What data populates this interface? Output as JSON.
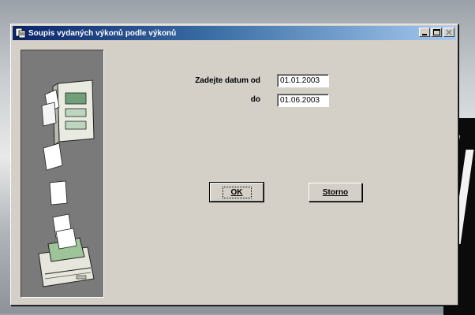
{
  "window": {
    "title": "Soupis vydaných výkonů podle výkonů"
  },
  "form": {
    "label_from": "Zadejte datum od",
    "label_to": "do",
    "date_from": "01.01.2003",
    "date_to": "01.06.2003"
  },
  "buttons": {
    "ok_label": "OK",
    "cancel_label": "Storno"
  },
  "icons": {
    "app": "app-icon",
    "minimize": "minimize-icon",
    "maximize": "maximize-icon",
    "close": "close-icon",
    "illustration": "printer-illustration"
  },
  "colors": {
    "title_start": "#0a246a",
    "title_end": "#a6caf0",
    "face": "#d4d0c8",
    "side_panel": "#7a7a7a"
  }
}
